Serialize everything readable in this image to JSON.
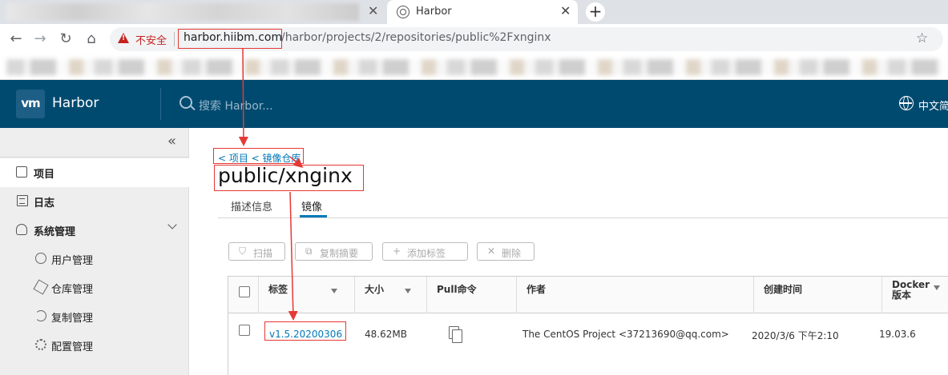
{
  "browser": {
    "active_tab_title": "Harbor",
    "close_glyph": "✕",
    "new_tab_glyph": "+",
    "insecure_label": "不安全",
    "url_host": "harbor.hiibm.com",
    "url_path": "/harbor/projects/2/repositories/public%2Fxnginx",
    "star_glyph": "☆",
    "nav": {
      "back": "←",
      "forward": "→",
      "reload": "↻",
      "home": "⌂"
    }
  },
  "header": {
    "logo": "vm",
    "brand": "Harbor",
    "search_placeholder": "搜索 Harbor...",
    "language": "中文简体"
  },
  "sidebar": {
    "collapse_glyph": "«",
    "items": [
      {
        "label": "项目",
        "icon": "projects-icon"
      },
      {
        "label": "日志",
        "icon": "logs-icon"
      },
      {
        "label": "系统管理",
        "icon": "admin-icon"
      },
      {
        "label": "用户管理",
        "icon": "users-icon"
      },
      {
        "label": "仓库管理",
        "icon": "registries-icon"
      },
      {
        "label": "复制管理",
        "icon": "replication-icon"
      },
      {
        "label": "配置管理",
        "icon": "configuration-icon"
      }
    ]
  },
  "main": {
    "breadcrumb": "< 项目 < 镜像仓库",
    "title": "public/xnginx",
    "tabs": [
      "描述信息",
      "镜像"
    ],
    "buttons": [
      {
        "label": "扫描",
        "icon": "shield-icon"
      },
      {
        "label": "复制摘要",
        "icon": "copy-icon"
      },
      {
        "label": "添加标签",
        "icon": "plus-icon"
      },
      {
        "label": "删除",
        "icon": "close-icon"
      }
    ],
    "table": {
      "columns": [
        "标签",
        "大小",
        "Pull命令",
        "作者",
        "创建时间",
        "Docker",
        "版本"
      ],
      "rows": [
        {
          "tag": "v1.5.20200306",
          "size": "48.62MB",
          "author": "The CentOS Project <37213690@qq.com>",
          "created": "2020/3/6 下午2:10",
          "docker_version": "19.03.6"
        }
      ]
    }
  },
  "colors": {
    "header_bg": "#004a70",
    "link": "#0079b8",
    "annotation": "#e53935",
    "insecure": "#c5221f"
  }
}
